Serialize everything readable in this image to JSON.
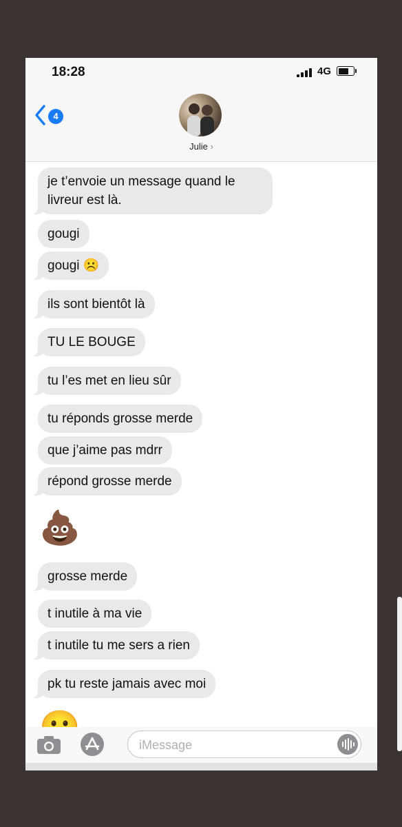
{
  "status_bar": {
    "time": "18:28",
    "network": "4G"
  },
  "header": {
    "back_badge": "4",
    "contact_name": "Julie",
    "contact_chevron": "›"
  },
  "messages": [
    {
      "text": "je t’envoie un message quand le livreur est là."
    },
    {
      "text": "gougi"
    },
    {
      "text": "gougi ☹️"
    },
    {
      "text": "ils sont bientôt là"
    },
    {
      "text": "TU LE BOUGE"
    },
    {
      "text": "tu l’es met en lieu sûr"
    },
    {
      "text": "tu réponds grosse merde"
    },
    {
      "text": "que j’aime pas mdrr"
    },
    {
      "text": "répond grosse merde"
    },
    {
      "emoji": "💩"
    },
    {
      "text": "grosse merde"
    },
    {
      "text": "t inutile à ma vie"
    },
    {
      "text": "t inutile tu me sers a rien"
    },
    {
      "text": "pk tu reste jamais avec moi"
    },
    {
      "emoji": "😀"
    }
  ],
  "composer": {
    "placeholder": "iMessage"
  },
  "icons": {
    "back": "chevron-left-icon",
    "camera": "camera-icon",
    "app_store": "app-store-icon",
    "voice": "audio-waveform-icon",
    "signal": "cellular-signal-icon",
    "battery": "battery-icon"
  },
  "colors": {
    "accent": "#1a7cf5",
    "bubble": "#e9e9eb",
    "background": "#3b3331"
  }
}
